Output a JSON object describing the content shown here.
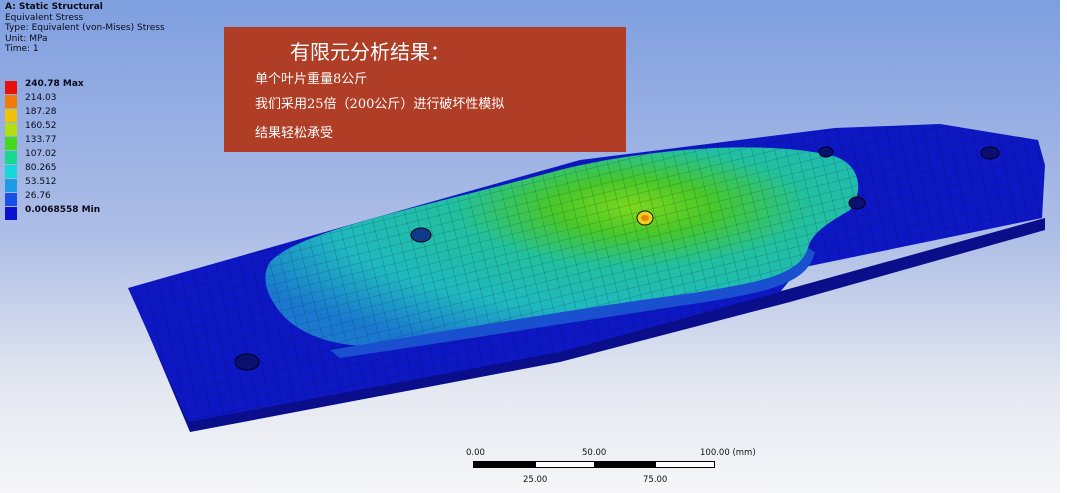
{
  "header": {
    "analysis_title": "A: Static Structural",
    "result_name": "Equivalent Stress",
    "type_line": "Type: Equivalent (von-Mises) Stress",
    "unit_line": "Unit: MPa",
    "time_line": "Time: 1"
  },
  "legend": {
    "entries": [
      {
        "label": "240.78 Max",
        "color": "#e8100c",
        "bold": true
      },
      {
        "label": "214.03",
        "color": "#f07a0c",
        "bold": false
      },
      {
        "label": "187.28",
        "color": "#f0c20c",
        "bold": false
      },
      {
        "label": "160.52",
        "color": "#b4de14",
        "bold": false
      },
      {
        "label": "133.77",
        "color": "#44d81e",
        "bold": false
      },
      {
        "label": "107.02",
        "color": "#18d890",
        "bold": false
      },
      {
        "label": "80.265",
        "color": "#16d8d8",
        "bold": false
      },
      {
        "label": "53.512",
        "color": "#1c9be6",
        "bold": false
      },
      {
        "label": "26.76",
        "color": "#1650e6",
        "bold": false
      },
      {
        "label": "0.0068558 Min",
        "color": "#0c10d0",
        "bold": true
      }
    ]
  },
  "info_box": {
    "title": "有限元分析结果：",
    "lines": [
      "单个叶片重量8公斤",
      "我们采用25倍（200公斤）进行破坏性模拟",
      "结果轻松承受"
    ],
    "background": "#b03d25"
  },
  "scale_bar": {
    "top_labels": [
      "0.00",
      "50.00",
      "100.00 (mm)"
    ],
    "bottom_labels": [
      "25.00",
      "75.00"
    ]
  },
  "colors": {
    "mesh_dark_blue": "#0d18b8",
    "mesh_cyan": "#27c8c0",
    "mesh_green": "#3cc02a",
    "background_top": "#7f9fe0"
  }
}
